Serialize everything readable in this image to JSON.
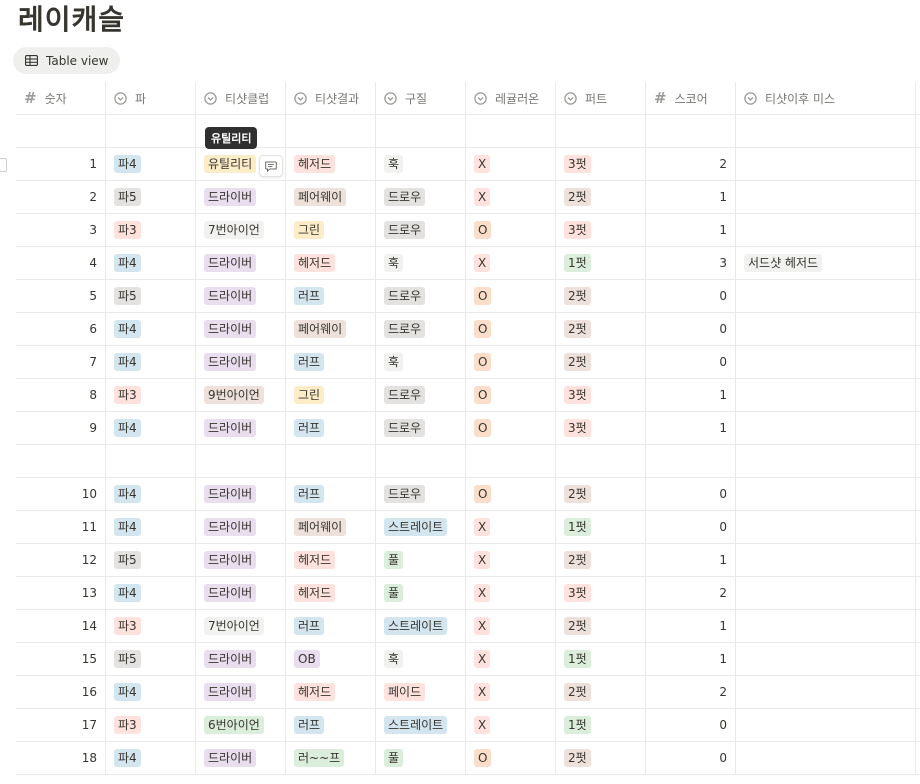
{
  "page": {
    "title": "레이캐슬"
  },
  "view": {
    "label": "Table view"
  },
  "columns": [
    {
      "label": "숫자",
      "type": "number"
    },
    {
      "label": "파",
      "type": "select"
    },
    {
      "label": "티샷클럽",
      "type": "select"
    },
    {
      "label": "티샷결과",
      "type": "select"
    },
    {
      "label": "구질",
      "type": "select"
    },
    {
      "label": "레귤러온",
      "type": "select"
    },
    {
      "label": "퍼트",
      "type": "select"
    },
    {
      "label": "스코어",
      "type": "number"
    },
    {
      "label": "티샷이후 미스",
      "type": "select"
    }
  ],
  "tooltip": {
    "text": "유틸리티"
  },
  "rows": [
    {
      "empty": true
    },
    {
      "n": "1",
      "par": "파4",
      "club": "유틸리티",
      "result": "헤저드",
      "shape": "훅",
      "gir": "X",
      "putt": "3펏",
      "score": "2",
      "miss": ""
    },
    {
      "n": "2",
      "par": "파5",
      "club": "드라이버",
      "result": "페어웨이",
      "shape": "드로우",
      "gir": "X",
      "putt": "2펏",
      "score": "1",
      "miss": ""
    },
    {
      "n": "3",
      "par": "파3",
      "club": "7번아이언",
      "result": "그린",
      "shape": "드로우",
      "gir": "O",
      "putt": "3펏",
      "score": "1",
      "miss": ""
    },
    {
      "n": "4",
      "par": "파4",
      "club": "드라이버",
      "result": "헤저드",
      "shape": "훅",
      "gir": "X",
      "putt": "1펏",
      "score": "3",
      "miss": "서드샷 헤저드"
    },
    {
      "n": "5",
      "par": "파5",
      "club": "드라이버",
      "result": "러프",
      "shape": "드로우",
      "gir": "O",
      "putt": "2펏",
      "score": "0",
      "miss": ""
    },
    {
      "n": "6",
      "par": "파4",
      "club": "드라이버",
      "result": "페어웨이",
      "shape": "드로우",
      "gir": "O",
      "putt": "2펏",
      "score": "0",
      "miss": ""
    },
    {
      "n": "7",
      "par": "파4",
      "club": "드라이버",
      "result": "러프",
      "shape": "훅",
      "gir": "O",
      "putt": "2펏",
      "score": "0",
      "miss": ""
    },
    {
      "n": "8",
      "par": "파3",
      "club": "9번아이언",
      "result": "그린",
      "shape": "드로우",
      "gir": "O",
      "putt": "3펏",
      "score": "1",
      "miss": ""
    },
    {
      "n": "9",
      "par": "파4",
      "club": "드라이버",
      "result": "러프",
      "shape": "드로우",
      "gir": "O",
      "putt": "3펏",
      "score": "1",
      "miss": ""
    },
    {
      "empty": true
    },
    {
      "n": "10",
      "par": "파4",
      "club": "드라이버",
      "result": "러프",
      "shape": "드로우",
      "gir": "O",
      "putt": "2펏",
      "score": "0",
      "miss": ""
    },
    {
      "n": "11",
      "par": "파4",
      "club": "드라이버",
      "result": "페어웨이",
      "shape": "스트레이트",
      "gir": "X",
      "putt": "1펏",
      "score": "0",
      "miss": ""
    },
    {
      "n": "12",
      "par": "파5",
      "club": "드라이버",
      "result": "헤저드",
      "shape": "풀",
      "gir": "X",
      "putt": "2펏",
      "score": "1",
      "miss": ""
    },
    {
      "n": "13",
      "par": "파4",
      "club": "드라이버",
      "result": "헤저드",
      "shape": "풀",
      "gir": "X",
      "putt": "3펏",
      "score": "2",
      "miss": ""
    },
    {
      "n": "14",
      "par": "파3",
      "club": "7번아이언",
      "result": "러프",
      "shape": "스트레이트",
      "gir": "X",
      "putt": "2펏",
      "score": "1",
      "miss": ""
    },
    {
      "n": "15",
      "par": "파5",
      "club": "드라이버",
      "result": "OB",
      "shape": "훅",
      "gir": "X",
      "putt": "1펏",
      "score": "1",
      "miss": ""
    },
    {
      "n": "16",
      "par": "파4",
      "club": "드라이버",
      "result": "헤저드",
      "shape": "페이드",
      "gir": "X",
      "putt": "2펏",
      "score": "2",
      "miss": ""
    },
    {
      "n": "17",
      "par": "파3",
      "club": "6번아이언",
      "result": "러프",
      "shape": "스트레이트",
      "gir": "X",
      "putt": "1펏",
      "score": "0",
      "miss": ""
    },
    {
      "n": "18",
      "par": "파4",
      "club": "드라이버",
      "result": "러~~프",
      "shape": "풀",
      "gir": "O",
      "putt": "2펏",
      "score": "0",
      "miss": ""
    }
  ],
  "tag_colors": {
    "파4": "t-blue",
    "파5": "t-gray",
    "파3": "t-red",
    "유틸리티": "t-yellow",
    "드라이버": "t-purple",
    "7번아이언": "t-plain",
    "9번아이언": "t-brown",
    "6번아이언": "t-green",
    "헤저드": "t-red",
    "페어웨이": "t-brown",
    "그린": "t-yellow",
    "러프": "t-blue",
    "OB": "t-purple",
    "러~~프": "t-green",
    "훅": "t-plain",
    "드로우": "t-gray",
    "스트레이트": "t-blue",
    "풀": "t-green",
    "페이드": "t-red",
    "X": "t-red",
    "O": "t-orange",
    "3펏": "t-red",
    "2펏": "t-brown",
    "1펏": "t-green",
    "서드샷 헤저드": "t-plain"
  }
}
